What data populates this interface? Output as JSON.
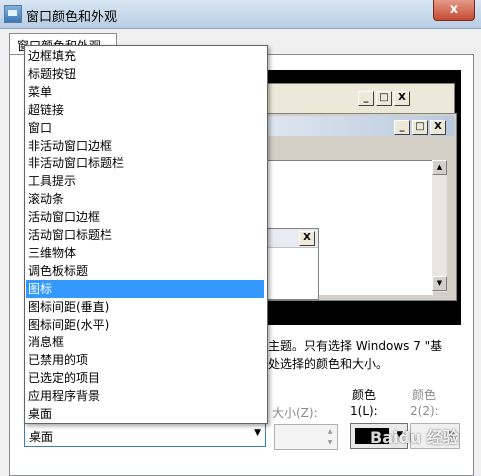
{
  "window": {
    "title": "窗口颜色和外观",
    "close_label": "x"
  },
  "tab": {
    "label": "窗口颜色和外观"
  },
  "preview": {
    "caption_buttons": [
      "_",
      "□",
      "X"
    ],
    "scroll_up": "▲",
    "scroll_down": "▼",
    "msgbox_close": "X"
  },
  "description": {
    "line1": "主题。只有选择 Windows 7 \"基",
    "line2": "处选择的颜色和大小。"
  },
  "item_dropdown": {
    "items": [
      "边框填充",
      "标题按钮",
      "菜单",
      "超链接",
      "窗口",
      "非活动窗口边框",
      "非活动窗口标题栏",
      "工具提示",
      "滚动条",
      "活动窗口边框",
      "活动窗口标题栏",
      "三维物体",
      "调色板标题",
      "图标",
      "图标间距(垂直)",
      "图标间距(水平)",
      "消息框",
      "已禁用的项",
      "已选定的项目",
      "应用程序背景",
      "桌面"
    ],
    "selected_index": 13,
    "current_value": "桌面"
  },
  "labels": {
    "size": "大小(Z):",
    "color1_top": "颜色",
    "color1_bottom": "1(L):",
    "color2_top": "颜色",
    "color2_bottom": "2(2):"
  },
  "colors": {
    "selection": "#3399ff",
    "color1_swatch": "#000000"
  },
  "watermark": "Baidu 经验"
}
